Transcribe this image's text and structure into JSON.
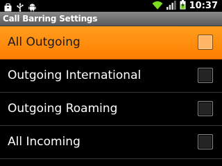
{
  "status_bar": {
    "time": "10:37",
    "icons": {
      "left": [
        "bag-icon",
        "usb-icon",
        "android-icon"
      ],
      "right": [
        "wifi-icon",
        "signal-icon",
        "battery-charging-icon"
      ]
    },
    "colors": {
      "wifi": "#7ddc1f",
      "battery": "#7ddc1f"
    }
  },
  "title_bar": {
    "title": "Call Barring Settings"
  },
  "list": {
    "items": [
      {
        "label": "All Outgoing",
        "checked": false,
        "selected": true
      },
      {
        "label": "Outgoing International",
        "checked": false,
        "selected": false
      },
      {
        "label": "Outgoing Roaming",
        "checked": false,
        "selected": false
      },
      {
        "label": "All Incoming",
        "checked": false,
        "selected": false
      }
    ]
  },
  "colors": {
    "selection": "#ff8a00",
    "background": "#000000"
  }
}
